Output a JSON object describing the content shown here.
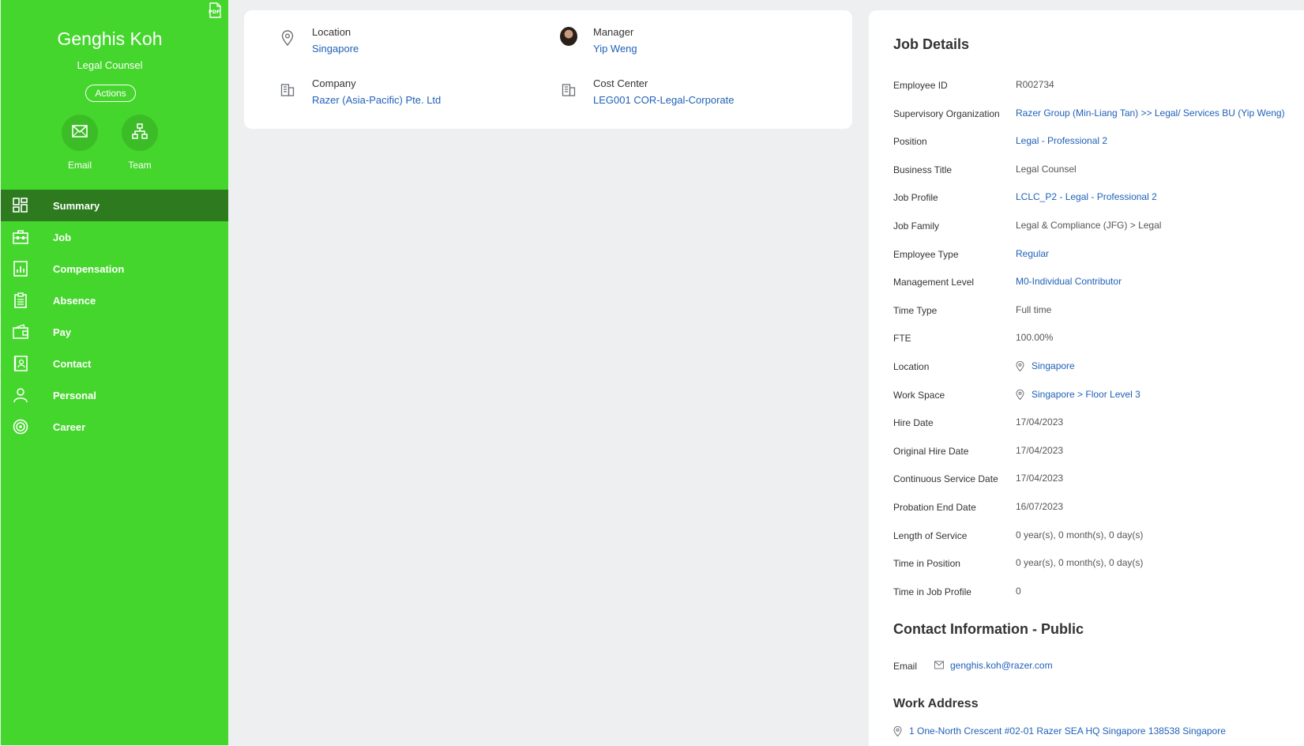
{
  "profile": {
    "name": "Genghis Koh",
    "title": "Legal Counsel",
    "actions_label": "Actions",
    "pdf_icon": "pdf-icon"
  },
  "quick_actions": [
    {
      "label": "Email",
      "icon": "mail-icon"
    },
    {
      "label": "Team",
      "icon": "org-chart-icon"
    }
  ],
  "nav": [
    {
      "label": "Summary",
      "icon": "dashboard-grid-icon",
      "active": true
    },
    {
      "label": "Job",
      "icon": "briefcase-icon"
    },
    {
      "label": "Compensation",
      "icon": "bar-chart-icon"
    },
    {
      "label": "Absence",
      "icon": "clipboard-icon"
    },
    {
      "label": "Pay",
      "icon": "wallet-icon"
    },
    {
      "label": "Contact",
      "icon": "address-book-icon"
    },
    {
      "label": "Personal",
      "icon": "person-icon"
    },
    {
      "label": "Career",
      "icon": "target-icon"
    }
  ],
  "summary": {
    "location": {
      "label": "Location",
      "value": "Singapore"
    },
    "manager": {
      "label": "Manager",
      "value": "Yip Weng"
    },
    "company": {
      "label": "Company",
      "value": "Razer (Asia-Pacific) Pte. Ltd"
    },
    "cost_center": {
      "label": "Cost Center",
      "value": "LEG001 COR-Legal-Corporate"
    }
  },
  "job_details": {
    "title": "Job Details",
    "rows": [
      {
        "label": "Employee ID",
        "value": "R002734",
        "link": false
      },
      {
        "label": "Supervisory Organization",
        "value": "Razer Group (Min-Liang Tan) >> Legal/ Services BU (Yip Weng)",
        "link": true
      },
      {
        "label": "Position",
        "value": "Legal - Professional 2",
        "link": true
      },
      {
        "label": "Business Title",
        "value": "Legal Counsel",
        "link": false
      },
      {
        "label": "Job Profile",
        "value": "LCLC_P2 - Legal - Professional 2",
        "link": true
      },
      {
        "label": "Job Family",
        "value": "Legal & Compliance (JFG) > Legal",
        "link": false
      },
      {
        "label": "Employee Type",
        "value": "Regular",
        "link": true
      },
      {
        "label": "Management Level",
        "value": "M0-Individual Contributor",
        "link": true
      },
      {
        "label": "Time Type",
        "value": "Full time",
        "link": false
      },
      {
        "label": "FTE",
        "value": "100.00%",
        "link": false
      },
      {
        "label": "Location",
        "value": "Singapore",
        "link": true,
        "icon": "location-pin-icon"
      },
      {
        "label": "Work Space",
        "value": "Singapore > Floor Level 3",
        "link": true,
        "icon": "location-pin-icon"
      },
      {
        "label": "Hire Date",
        "value": "17/04/2023",
        "link": false
      },
      {
        "label": "Original Hire Date",
        "value": "17/04/2023",
        "link": false
      },
      {
        "label": "Continuous Service Date",
        "value": "17/04/2023",
        "link": false
      },
      {
        "label": "Probation End Date",
        "value": "16/07/2023",
        "link": false
      },
      {
        "label": "Length of Service",
        "value": "0 year(s), 0 month(s), 0 day(s)",
        "link": false
      },
      {
        "label": "Time in Position",
        "value": "0 year(s), 0 month(s), 0 day(s)",
        "link": false
      },
      {
        "label": "Time in Job Profile",
        "value": "0",
        "link": false
      }
    ]
  },
  "contact_public": {
    "title": "Contact Information - Public",
    "email_label": "Email",
    "email_value": "genghis.koh@razer.com"
  },
  "work_address": {
    "title": "Work Address",
    "value": "1 One-North Crescent #02-01 Razer SEA HQ Singapore 138538 Singapore"
  },
  "colors": {
    "sidebar": "#44d62c",
    "sidebar_active": "#2d7a1f",
    "link": "#1f61b8",
    "background": "#eeeff1"
  }
}
